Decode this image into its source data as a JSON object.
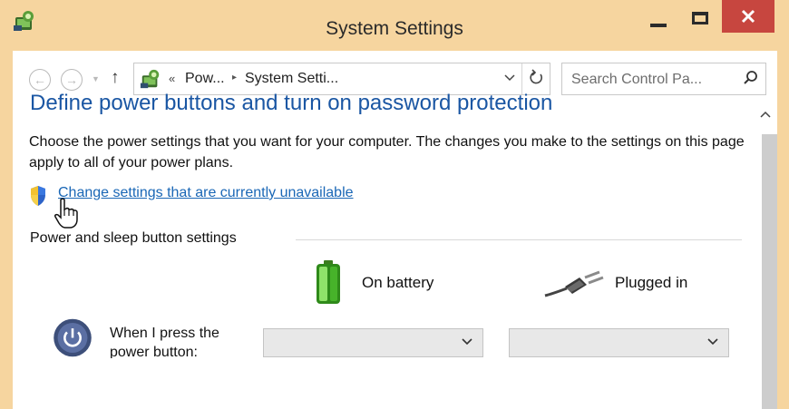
{
  "window": {
    "title": "System Settings",
    "icon": "control-panel-icon",
    "colors": {
      "frame": "#f6d59f",
      "close": "#c7463f",
      "heading": "#1a56a3",
      "link": "#1a67b6"
    }
  },
  "nav": {
    "back_icon": "back-arrow-icon",
    "forward_icon": "forward-arrow-icon",
    "up_icon": "up-arrow-icon",
    "address": {
      "overflow_glyph": "«",
      "crumbs": [
        "Pow...",
        "System Setti..."
      ],
      "separator": "▸"
    },
    "search": {
      "placeholder": "Search Control Pa..."
    }
  },
  "content": {
    "heading": "Define power buttons and turn on password protection",
    "description": "Choose the power settings that you want for your computer. The changes you make to the settings on this page apply to all of your power plans.",
    "link": "Change settings that are currently unavailable",
    "group_label": "Power and sleep button settings",
    "columns": {
      "battery": "On battery",
      "plugged": "Plugged in"
    },
    "rows": [
      {
        "label": "When I press the power button:",
        "battery_value": "",
        "plugged_value": ""
      }
    ]
  }
}
